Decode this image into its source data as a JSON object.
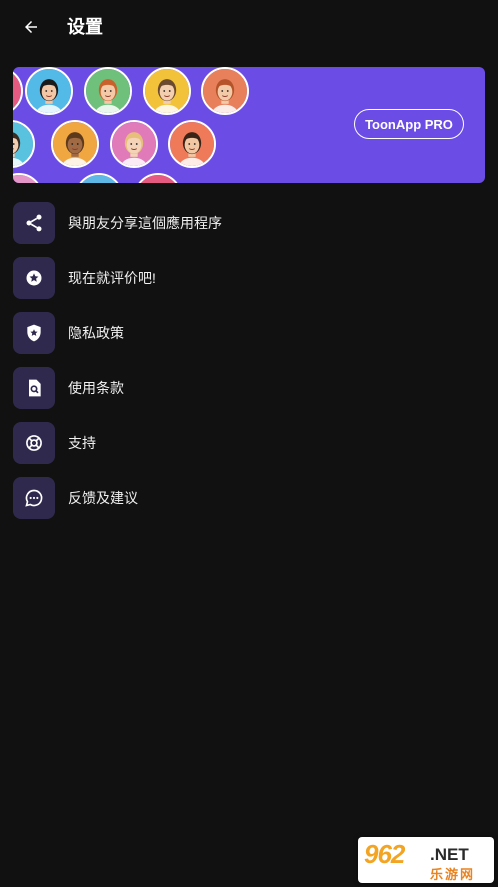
{
  "header": {
    "title": "设置"
  },
  "banner": {
    "pro_label": "ToonApp PRO",
    "background": "#6b4de6",
    "avatars": [
      {
        "bg": "#e45a80",
        "skin": "#7a4a2e",
        "hair": "#1e1410"
      },
      {
        "bg": "#53b9e6",
        "skin": "#f1c7a6",
        "hair": "#1b1b1b"
      },
      {
        "bg": "#6fc07a",
        "skin": "#f4c9a8",
        "hair": "#c8612c"
      },
      {
        "bg": "#f2c23a",
        "skin": "#f3cfb0",
        "hair": "#6b4a2e"
      },
      {
        "bg": "#e8805c",
        "skin": "#f3caa8",
        "hair": "#b5542a"
      },
      {
        "bg": "#59c2de",
        "skin": "#f2cdb0",
        "hair": "#3a2a20"
      },
      {
        "bg": "#f0a742",
        "skin": "#a06a45",
        "hair": "#5e3a1c"
      },
      {
        "bg": "#e07ab8",
        "skin": "#f5d3b8",
        "hair": "#e6c07a"
      },
      {
        "bg": "#ef7a5a",
        "skin": "#f2c7a3",
        "hair": "#3a2418"
      },
      {
        "bg": "#e596c9",
        "skin": "#f3cdb0",
        "hair": "#2a1a14"
      },
      {
        "bg": "#5fb7e6",
        "skin": "#8a5a3a",
        "hair": "#1a1210"
      }
    ]
  },
  "menu": {
    "icon_bg": "#2f2a4d",
    "items": [
      {
        "label": "與朋友分享這個應用程序",
        "icon": "share-icon"
      },
      {
        "label": "现在就评价吧!",
        "icon": "star-badge-icon"
      },
      {
        "label": "隐私政策",
        "icon": "shield-star-icon"
      },
      {
        "label": "使用条款",
        "icon": "document-search-icon"
      },
      {
        "label": "支持",
        "icon": "lifebuoy-icon"
      },
      {
        "label": "反馈及建议",
        "icon": "chat-bubble-icon"
      }
    ]
  },
  "watermark": {
    "num": "962",
    "net": ".NET",
    "cn": "乐游网"
  }
}
